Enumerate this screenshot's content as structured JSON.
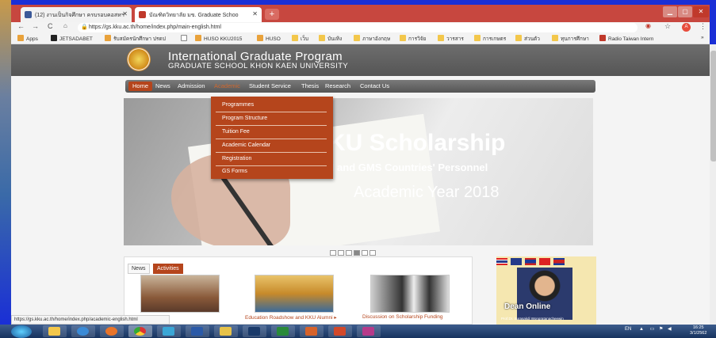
{
  "browser": {
    "tabs": [
      {
        "title": "(12) งานเป็นกิจศึกษา ครบรอบคอสหฯ ",
        "icon": "facebook-icon",
        "active": false
      },
      {
        "title": "บัณฑิตวิทยาลัย มข. Graduate Schoo",
        "icon": "kku-icon",
        "active": true
      }
    ],
    "new_tab_label": "+",
    "url": "https://gs.kku.ac.th/home/index.php/main-english.html",
    "bookmarks": [
      "Apps",
      "JETSADABET",
      "รับสมัครนักศึกษา ปรดป",
      "",
      "HUSO KKU2015",
      "HUSO",
      "เว็บ",
      "บันเทิง",
      "ภาษาอังกฤษ",
      "การวิจัย",
      "วารสาร",
      "การเกษตร",
      "ส่วนตัว",
      "ทุนการศึกษา",
      "Radio Taiwan Intern"
    ],
    "more_bookmarks": "»",
    "status_url": "https://gs.kku.ac.th/home/index.php/academic-english.html"
  },
  "site": {
    "title": "International Graduate Program",
    "subtitle": "GRADUATE SCHOOL KHON KAEN UNIVERSITY",
    "menu": [
      "Home",
      "News",
      "Admission",
      "Academic",
      "Student Service",
      "Thesis",
      "Research",
      "Contact Us"
    ],
    "dropdown": [
      "Programmes",
      "Program Structure",
      "Tuition Fee",
      "Academic Calendar",
      "Registration",
      "GS Forms"
    ],
    "banner": {
      "line1": "KU Scholarship",
      "line2": "EAN and GMS Countries' Personnel",
      "line3": "Academic Year 2018"
    },
    "news_tabs": [
      "News",
      "Activities"
    ],
    "news_captions": [
      "",
      "Education Roadshow and KKU Alumni ▸",
      "Discussion on Scholarship Funding"
    ],
    "dean_title": "Dean Online",
    "dean_name": "Prof.Dr. Surasakdi Wongratanacheewin"
  },
  "taskbar": {
    "tray_lang": "EN",
    "time": "16:25",
    "date": "3/1/2562"
  },
  "colors": {
    "accent": "#b5451c",
    "header": "#5e5e5e",
    "chrome_tab": "#c7473f"
  }
}
